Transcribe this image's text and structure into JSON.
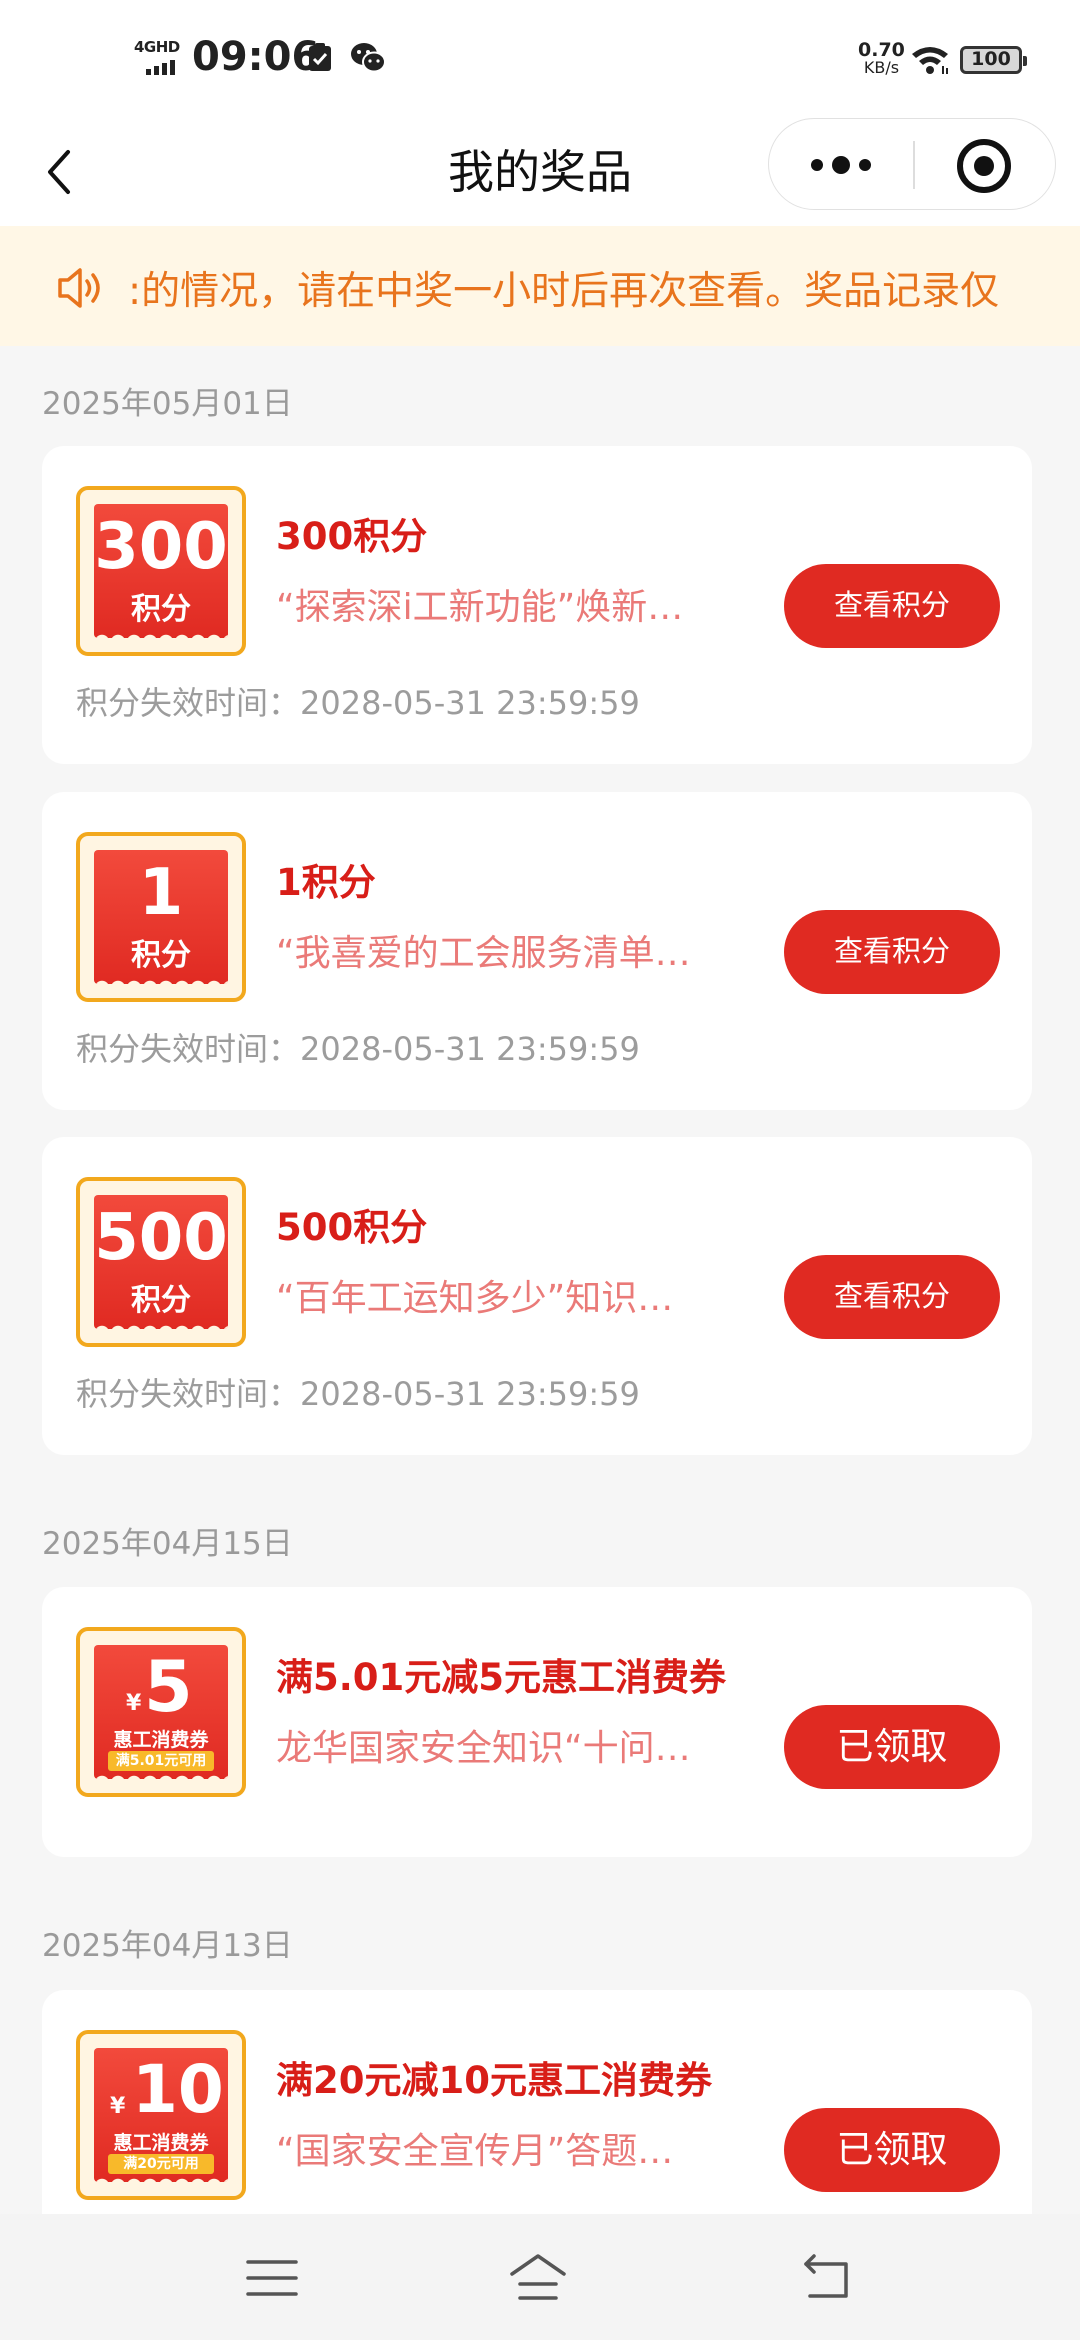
{
  "status_bar": {
    "network": "4GHD",
    "time": "09:06",
    "speed_value": "0.70",
    "speed_unit": "KB/s",
    "battery": "100"
  },
  "nav": {
    "title": "我的奖品"
  },
  "notice": {
    "text": ":的情况，请在中奖一小时后再次查看。奖品记录仅"
  },
  "groups": [
    {
      "date": "2025年05月01日",
      "items": [
        {
          "badge_number": "300",
          "badge_unit": "积分",
          "title": "300积分",
          "desc": "“探索深i工新功能”焕新…",
          "expire": "积分失效时间：2028-05-31 23:59:59",
          "button": "查看积分"
        },
        {
          "badge_number": "1",
          "badge_unit": "积分",
          "title": "1积分",
          "desc": "“我喜爱的工会服务清单…",
          "expire": "积分失效时间：2028-05-31 23:59:59",
          "button": "查看积分"
        },
        {
          "badge_number": "500",
          "badge_unit": "积分",
          "title": "500积分",
          "desc": "“百年工运知多少”知识…",
          "expire": "积分失效时间：2028-05-31 23:59:59",
          "button": "查看积分"
        }
      ]
    },
    {
      "date": "2025年04月15日",
      "items": [
        {
          "coupon_symbol": "¥",
          "coupon_value": "5",
          "coupon_name": "惠工消费券",
          "coupon_condition": "满5.01元可用",
          "title": "满5.01元减5元惠工消费券",
          "desc": "龙华国家安全知识“十问…",
          "button": "已领取"
        }
      ]
    },
    {
      "date": "2025年04月13日",
      "items": [
        {
          "coupon_symbol": "¥",
          "coupon_value": "10",
          "coupon_name": "惠工消费券",
          "coupon_condition": "满20元可用",
          "title": "满20元减10元惠工消费券",
          "desc": "“国家安全宣传月”答题…",
          "button": "已领取"
        }
      ]
    }
  ],
  "colors": {
    "accent": "#e02a22",
    "title_red": "#d81e18",
    "notice_bg": "#fff7e6",
    "notice_text": "#e8741d",
    "badge_border": "#f2a81d"
  }
}
